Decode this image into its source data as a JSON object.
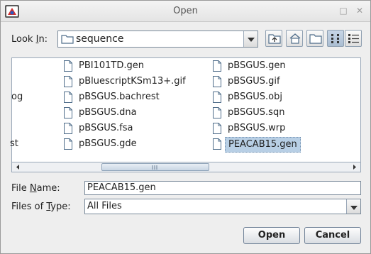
{
  "window": {
    "title": "Open",
    "minimize_glyph": "□",
    "close_glyph": "✕"
  },
  "look_in": {
    "label_pre": "Look ",
    "label_mnemonic": "I",
    "label_post": "n:",
    "value": "sequence"
  },
  "toolbar": {
    "icons": [
      "up-folder-icon",
      "home-icon",
      "new-folder-icon",
      "list-view-icon",
      "details-view-icon"
    ],
    "active_view": "list-view-icon"
  },
  "files": {
    "column0": [
      "og",
      "st"
    ],
    "column1": [
      "PBI101TD.gen",
      "pBluescriptKSm13+.gif",
      "pBSGUS.bachrest",
      "pBSGUS.dna",
      "pBSGUS.fsa",
      "pBSGUS.gde"
    ],
    "column2": [
      "pBSGUS.gen",
      "pBSGUS.gif",
      "pBSGUS.obj",
      "pBSGUS.sqn",
      "pBSGUS.wrp",
      "PEACAB15.gen"
    ],
    "selected": "PEACAB15.gen"
  },
  "file_name": {
    "label_pre": "File ",
    "label_mnemonic": "N",
    "label_post": "ame:",
    "value": "PEACAB15.gen"
  },
  "files_of_type": {
    "label_pre": "Files of ",
    "label_mnemonic": "T",
    "label_post": "ype:",
    "value": "All Files"
  },
  "buttons": {
    "open": "Open",
    "cancel": "Cancel"
  },
  "colors": {
    "selection": "#b8cfe5",
    "folder_outline": "#4f6d8a"
  }
}
